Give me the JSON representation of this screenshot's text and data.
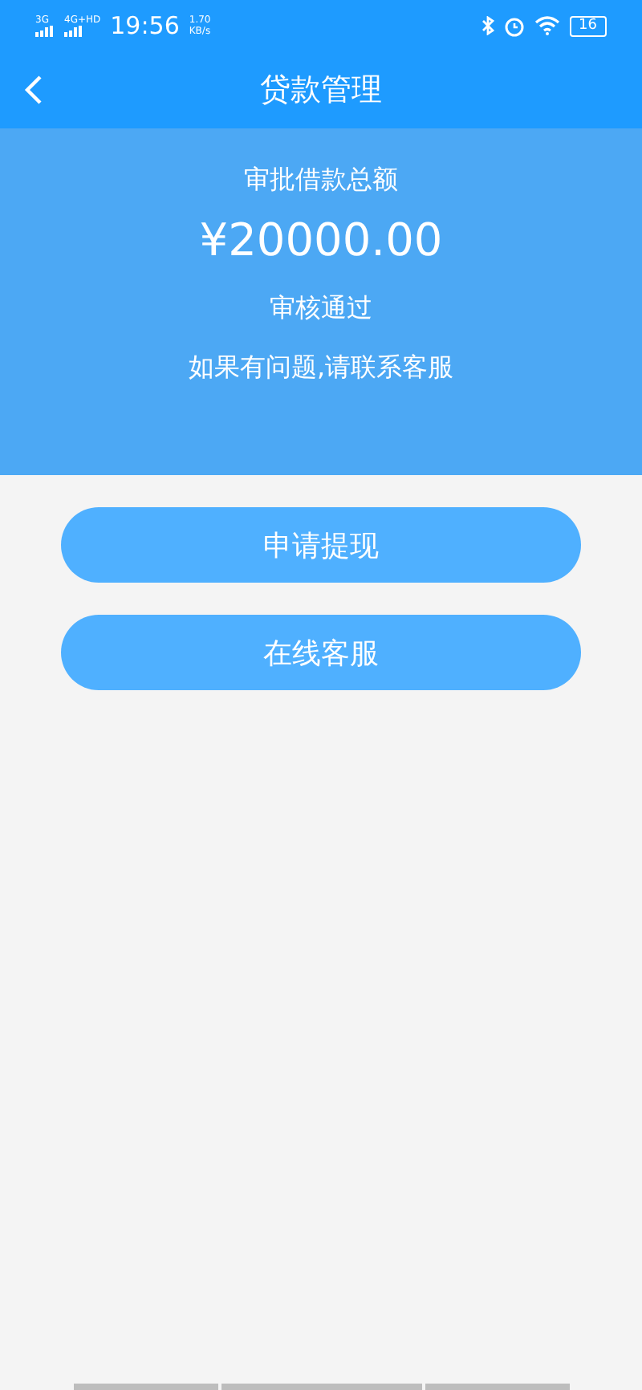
{
  "status_bar": {
    "network_1": "3G",
    "network_2": "4G+HD",
    "time": "19:56",
    "speed": "1.70",
    "speed_unit": "KB/s",
    "battery": "16"
  },
  "header": {
    "title": "贷款管理"
  },
  "summary": {
    "label": "审批借款总额",
    "amount": "¥20000.00",
    "status": "审核通过",
    "note": "如果有问题,请联系客服"
  },
  "buttons": [
    "申请提现",
    "在线客服"
  ]
}
